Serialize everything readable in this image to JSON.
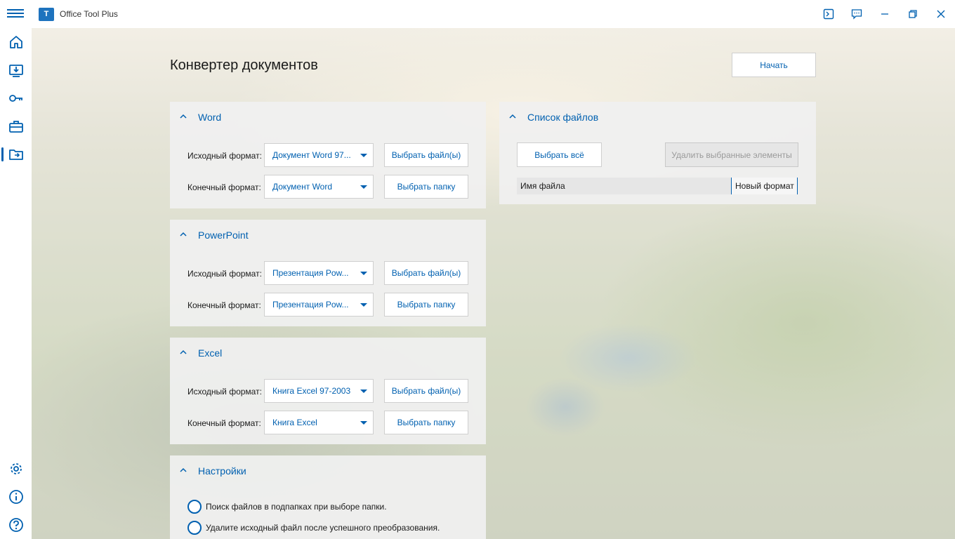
{
  "app": {
    "title": "Office Tool Plus",
    "logo_text": "T"
  },
  "titlebar_icons": [
    "terminal-icon",
    "feedback-icon",
    "minimize-icon",
    "restore-icon",
    "close-icon"
  ],
  "sidebar": {
    "items": [
      {
        "name": "home-icon"
      },
      {
        "name": "deploy-icon"
      },
      {
        "name": "activation-key-icon"
      },
      {
        "name": "toolbox-icon"
      },
      {
        "name": "document-converter-icon",
        "active": true
      },
      {
        "name": "settings-gear-icon"
      },
      {
        "name": "info-icon"
      },
      {
        "name": "help-icon"
      }
    ]
  },
  "page": {
    "title": "Конвертер документов",
    "start_label": "Начать"
  },
  "labels": {
    "source_format": "Исходный формат:",
    "target_format": "Конечный формат:",
    "select_files": "Выбрать файл(ы)",
    "select_folder": "Выбрать папку"
  },
  "word": {
    "title": "Word",
    "source": "Документ Word 97...",
    "target": "Документ Word"
  },
  "powerpoint": {
    "title": "PowerPoint",
    "source": "Презентация Pow...",
    "target": "Презентация Pow..."
  },
  "excel": {
    "title": "Excel",
    "source": "Книга Excel 97-2003",
    "target": "Книга Excel"
  },
  "settings": {
    "title": "Настройки",
    "options": [
      "Поиск файлов в подпапках при выборе папки.",
      "Удалите исходный файл после успешного преобразования."
    ]
  },
  "file_list": {
    "title": "Список файлов",
    "select_all": "Выбрать всё",
    "delete_selected": "Удалить выбранные элементы",
    "columns": [
      "Имя файла",
      "Новый формат"
    ]
  },
  "colors": {
    "accent": "#0060b0",
    "panel_bg": "#f0f0f0"
  }
}
